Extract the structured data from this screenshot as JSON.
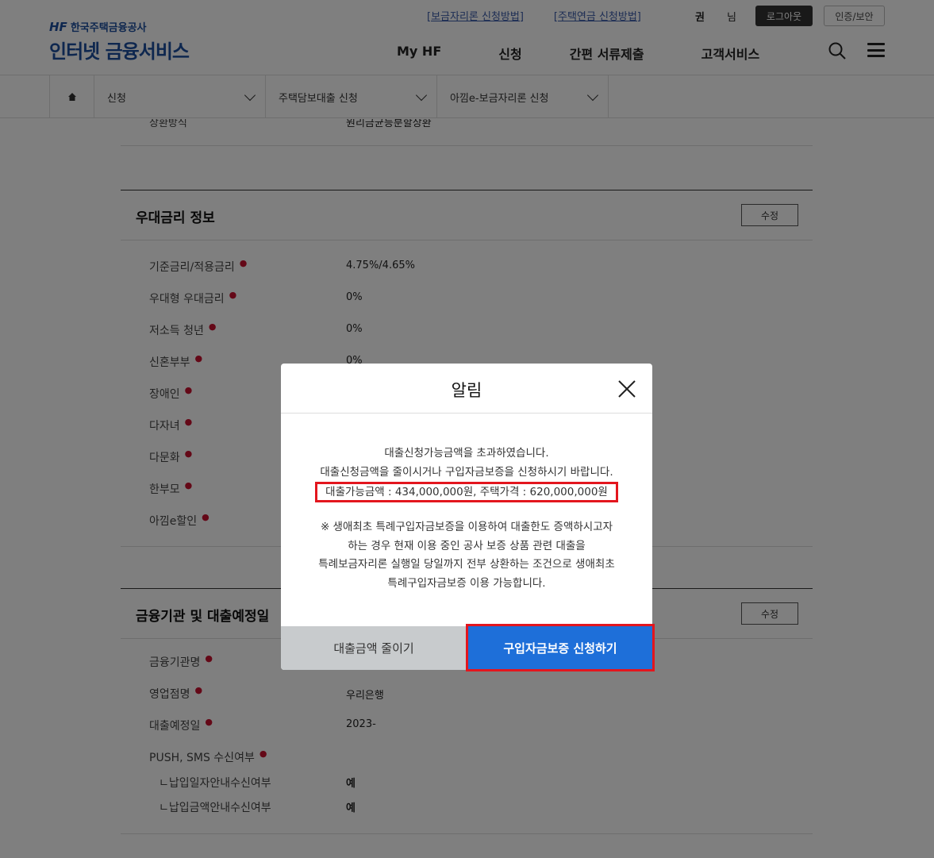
{
  "header": {
    "logo_brand": "한국주택금융공사",
    "logo_mark": "HF",
    "logo_title": "인터넷 금융서비스",
    "util_links": [
      "[보금자리론 신청방법]",
      "[주택연금 신청방법]"
    ],
    "user_name": "권",
    "user_suffix": "님",
    "logout_label": "로그아웃",
    "cert_label": "인증/보안",
    "nav": [
      "My HF",
      "신청",
      "간편 서류제출",
      "고객서비스"
    ]
  },
  "breadcrumb": [
    "신청",
    "주택담보대출 신청",
    "아낌e-보금자리론 신청"
  ],
  "content": {
    "partial_row": {
      "label": "상환방식",
      "value": "원리금균등분할상환"
    },
    "preferential": {
      "title": "우대금리 정보",
      "edit_label": "수정",
      "rows": [
        {
          "label": "기준금리/적용금리",
          "value": "4.75%/4.65%"
        },
        {
          "label": "우대형 우대금리",
          "value": "0%"
        },
        {
          "label": "저소득 청년",
          "value": "0%"
        },
        {
          "label": "신혼부부",
          "value": "0%"
        },
        {
          "label": "장애인",
          "value": ""
        },
        {
          "label": "다자녀",
          "value": ""
        },
        {
          "label": "다문화",
          "value": ""
        },
        {
          "label": "한부모",
          "value": ""
        },
        {
          "label": "아낌e할인",
          "value": ""
        }
      ]
    },
    "institution": {
      "title": "금융기관 및 대출예정일",
      "edit_label": "수정",
      "rows": [
        {
          "label": "금융기관명",
          "value": ""
        },
        {
          "label": "영업점명",
          "value": "우리은행"
        },
        {
          "label": "대출예정일",
          "value": "2023-"
        },
        {
          "label": "PUSH, SMS 수신여부",
          "value": ""
        }
      ],
      "sub_rows": [
        {
          "label": "ㄴ납입일자안내수신여부",
          "value": "예"
        },
        {
          "label": "ㄴ납입금액안내수신여부",
          "value": "예"
        }
      ]
    }
  },
  "modal": {
    "title": "알림",
    "line1": "대출신청가능금액을 초과하였습니다.",
    "line2": "대출신청금액을 줄이시거나 구입자금보증을 신청하시기 바랍니다.",
    "highlight": "대출가능금액 : 434,000,000원, 주택가격 : 620,000,000원",
    "note1": "※ 생애최초 특례구입자금보증을 이용하여 대출한도 증액하시고자",
    "note2": "하는 경우 현재 이용 중인 공사 보증 상품 관련 대출을",
    "note3": "특례보금자리론 실행일 당일까지 전부 상환하는 조건으로 생애최초",
    "note4": "특례구입자금보증 이용 가능합니다.",
    "btn_reduce": "대출금액 줄이기",
    "btn_apply": "구입자금보증 신청하기"
  },
  "colors": {
    "brand": "#1d4e9e",
    "primary_button": "#1e6fd9",
    "highlight_border": "#e3161e",
    "required_dot": "#c8102e"
  }
}
